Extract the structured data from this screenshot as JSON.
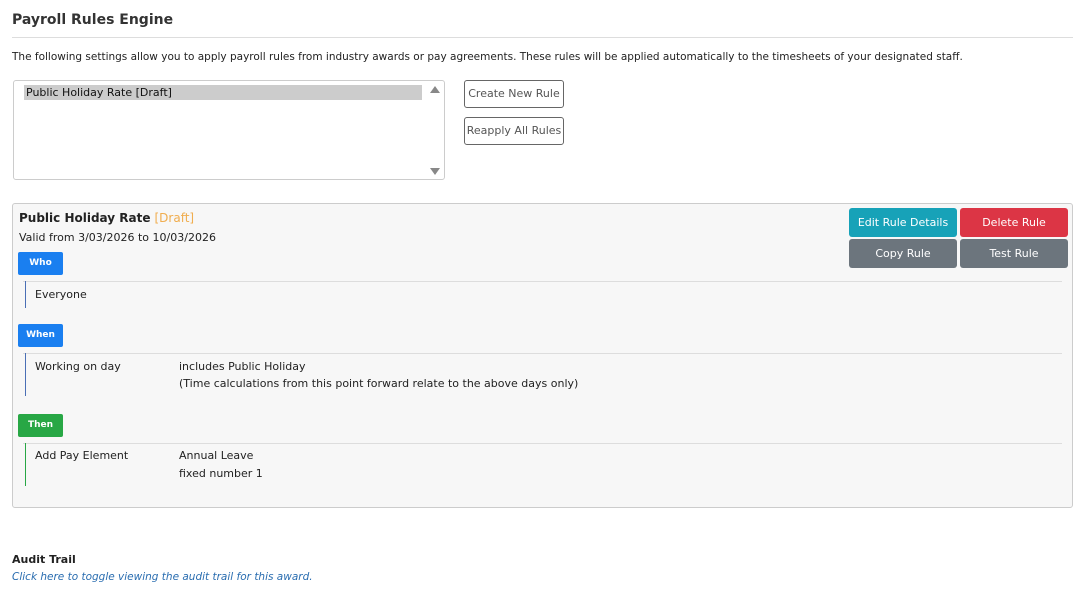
{
  "page": {
    "title": "Payroll Rules Engine",
    "intro": "The following settings allow you to apply payroll rules from industry awards or pay agreements. These rules will be applied automatically to the timesheets of your designated staff."
  },
  "rule_list": {
    "items": [
      "Public Holiday Rate [Draft]"
    ],
    "selected_index": 0
  },
  "list_buttons": {
    "create": "Create New Rule",
    "reapply": "Reapply All Rules"
  },
  "rule": {
    "name": "Public Holiday Rate",
    "status": "[Draft]",
    "validity": "Valid from 3/03/2026 to 10/03/2026",
    "buttons": {
      "edit": "Edit Rule Details",
      "delete": "Delete Rule",
      "copy": "Copy Rule",
      "test": "Test Rule"
    },
    "who": {
      "badge": "Who",
      "value": "Everyone"
    },
    "when": {
      "badge": "When",
      "label": "Working on day",
      "value": "includes Public Holiday",
      "note": "(Time calculations from this point forward relate to the above days only)"
    },
    "then": {
      "badge": "Then",
      "label": "Add Pay Element",
      "value": "Annual Leave",
      "detail": "fixed number 1"
    }
  },
  "audit": {
    "title": "Audit Trail",
    "link": "Click here to toggle viewing the audit trail for this award."
  },
  "colors": {
    "edit": "#17a2b8",
    "delete": "#dc3545",
    "neutral": "#6c757d",
    "badge_blue": "#1a7ff0",
    "badge_green": "#28a745",
    "draft": "#f0ad4e"
  }
}
